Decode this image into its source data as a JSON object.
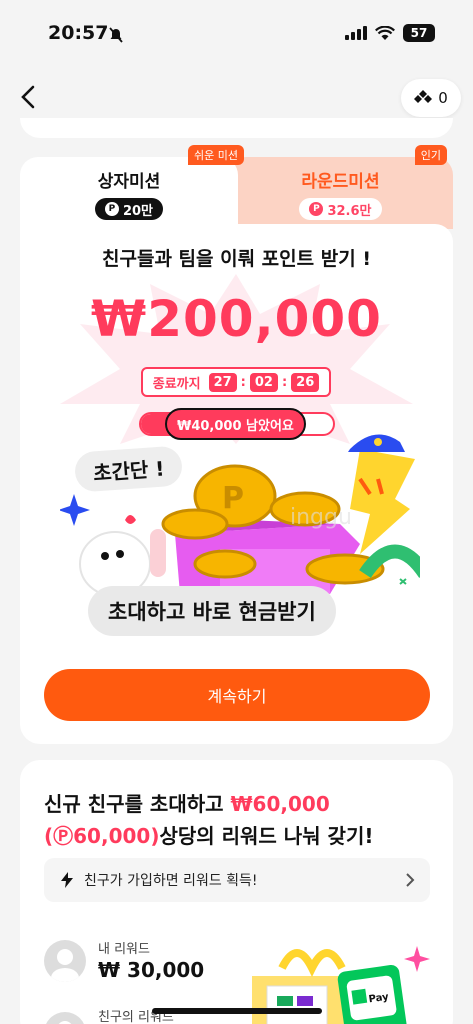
{
  "status": {
    "time": "20:57",
    "battery": "57"
  },
  "header": {
    "points": "0"
  },
  "tabs": [
    {
      "tag": "쉬운 미션",
      "title": "상자미션",
      "badge": "20만"
    },
    {
      "tag": "인기",
      "title": "라운드미션",
      "badge": "32.6만"
    }
  ],
  "mission": {
    "headline": "친구들과 팀을 이뤄 포인트 받기 !",
    "amount": "₩200,000",
    "timer_label": "종료까지",
    "timer": {
      "h": "27",
      "m": "02",
      "s": "26"
    },
    "remaining": "₩40,000 남았어요",
    "progress_fraction": 0.8,
    "easy_label": "초간단 !",
    "invite_label": "초대하고 바로 현금받기",
    "continue_label": "계속하기",
    "watermark": "inggu"
  },
  "reward": {
    "line1_prefix": "신규 친구를 초대하고 ",
    "line1_amount": "₩60,000",
    "line2_points": "(Ⓟ60,000)",
    "line2_suffix": "상당의 리워드 나눠 갖기!",
    "info": "친구가 가입하면 리워드 획득!",
    "my_label": "내 리워드",
    "my_value": "₩ 30,000",
    "friend_label": "친구의 리워드"
  },
  "colors": {
    "accent": "#ff5a0f",
    "red": "#ff3b5c",
    "peach": "#fcd3c4"
  }
}
